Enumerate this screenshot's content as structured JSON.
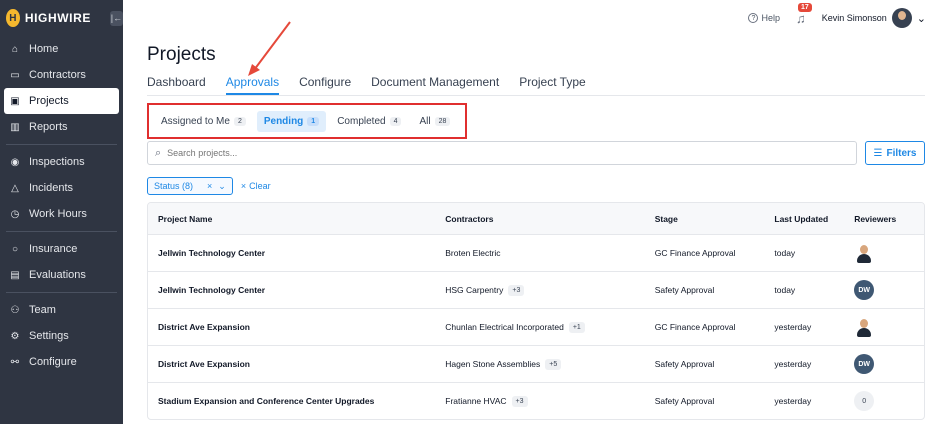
{
  "brand": {
    "logo_letter": "H",
    "name": "HIGHWIRE",
    "collapse_icon": "|←"
  },
  "sidebar": {
    "groups": [
      [
        {
          "label": "Home",
          "icon": "⌂"
        },
        {
          "label": "Contractors",
          "icon": "▭"
        },
        {
          "label": "Projects",
          "icon": "▣",
          "active": true
        },
        {
          "label": "Reports",
          "icon": "▥"
        }
      ],
      [
        {
          "label": "Inspections",
          "icon": "◉"
        },
        {
          "label": "Incidents",
          "icon": "△"
        },
        {
          "label": "Work Hours",
          "icon": "◷"
        }
      ],
      [
        {
          "label": "Insurance",
          "icon": "○"
        },
        {
          "label": "Evaluations",
          "icon": "▤"
        }
      ],
      [
        {
          "label": "Team",
          "icon": "⚇"
        },
        {
          "label": "Settings",
          "icon": "⚙"
        },
        {
          "label": "Configure",
          "icon": "⚯"
        }
      ]
    ]
  },
  "topbar": {
    "help_label": "Help",
    "help_icon": "?",
    "notifications_count": "17",
    "user_name": "Kevin Simonson",
    "chevron": "⌄"
  },
  "page": {
    "title": "Projects",
    "tabs": [
      "Dashboard",
      "Approvals",
      "Configure",
      "Document Management",
      "Project Type"
    ],
    "active_tab": "Approvals"
  },
  "filter_tabs": [
    {
      "label": "Assigned to Me",
      "count": "2"
    },
    {
      "label": "Pending",
      "count": "1",
      "active": true
    },
    {
      "label": "Completed",
      "count": "4"
    },
    {
      "label": "All",
      "count": "28"
    }
  ],
  "search": {
    "placeholder": "Search projects...",
    "icon": "⌕"
  },
  "filters_button": {
    "label": "Filters",
    "icon": "☰"
  },
  "chip": {
    "label": "Status (8)",
    "close": "×",
    "chevron": "⌄"
  },
  "clear": {
    "icon": "×",
    "label": "Clear"
  },
  "table": {
    "headers": [
      "Project Name",
      "Contractors",
      "Stage",
      "Last Updated",
      "Reviewers"
    ],
    "rows": [
      {
        "project": "Jellwin Technology Center",
        "contractor": "Broten Electric",
        "more": "",
        "stage": "GC Finance Approval",
        "updated": "today",
        "reviewer": {
          "type": "photo",
          "text": ""
        }
      },
      {
        "project": "Jellwin Technology Center",
        "contractor": "HSG Carpentry",
        "more": "+3",
        "stage": "Safety Approval",
        "updated": "today",
        "reviewer": {
          "type": "initials",
          "text": "DW"
        }
      },
      {
        "project": "District Ave Expansion",
        "contractor": "Chunlan Electrical Incorporated",
        "more": "+1",
        "stage": "GC Finance Approval",
        "updated": "yesterday",
        "reviewer": {
          "type": "photo",
          "text": ""
        }
      },
      {
        "project": "District Ave Expansion",
        "contractor": "Hagen Stone Assemblies",
        "more": "+5",
        "stage": "Safety Approval",
        "updated": "yesterday",
        "reviewer": {
          "type": "initials",
          "text": "DW"
        }
      },
      {
        "project": "Stadium Expansion and Conference Center Upgrades",
        "contractor": "Fratianne HVAC",
        "more": "+3",
        "stage": "Safety Approval",
        "updated": "yesterday",
        "reviewer": {
          "type": "count",
          "text": "0"
        }
      }
    ]
  },
  "colors": {
    "sidebar": "#2f3542",
    "accent": "#1e88e5",
    "annotation": "#e02f2f",
    "logo": "#f5b82e"
  }
}
